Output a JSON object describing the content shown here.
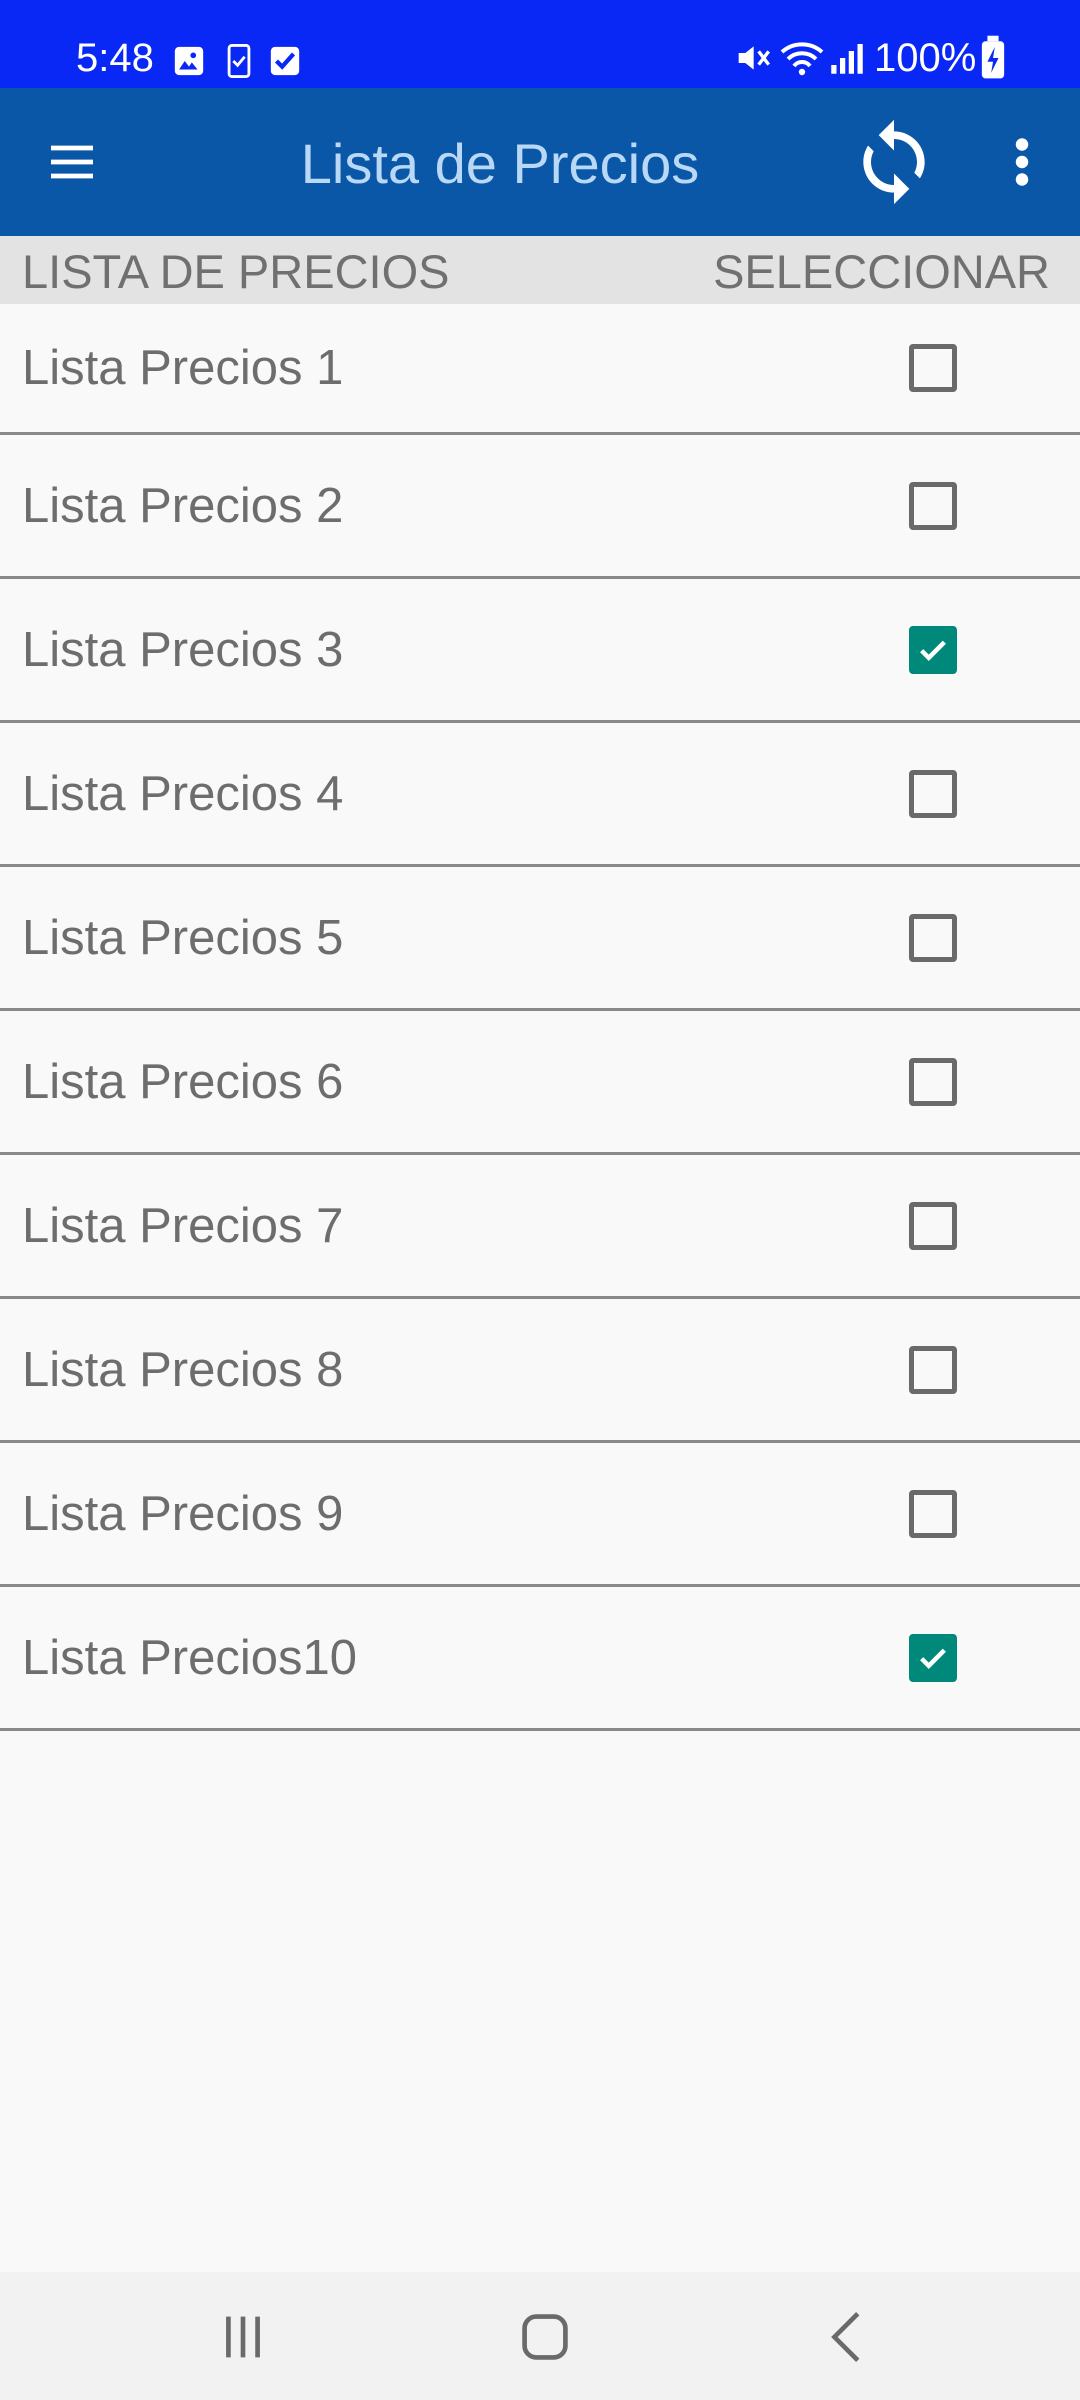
{
  "status_bar": {
    "time": "5:48",
    "battery": "100%",
    "icons": [
      "image-icon",
      "phone-icon",
      "check-box-icon",
      "mute-icon",
      "wifi-icon",
      "signal-icon",
      "battery-charging-icon"
    ]
  },
  "app_bar": {
    "title": "Lista de Precios",
    "icons": [
      "menu-icon",
      "sync-icon",
      "more-vert-icon"
    ]
  },
  "columns": {
    "name": "LISTA DE PRECIOS",
    "select": "SELECCIONAR"
  },
  "price_lists": [
    {
      "label": "Lista Precios 1",
      "checked": false
    },
    {
      "label": "Lista Precios 2",
      "checked": false
    },
    {
      "label": "Lista Precios 3",
      "checked": true
    },
    {
      "label": "Lista Precios 4",
      "checked": false
    },
    {
      "label": "Lista Precios 5",
      "checked": false
    },
    {
      "label": "Lista Precios 6",
      "checked": false
    },
    {
      "label": "Lista Precios 7",
      "checked": false
    },
    {
      "label": "Lista Precios 8",
      "checked": false
    },
    {
      "label": "Lista Precios 9",
      "checked": false
    },
    {
      "label": "Lista Precios10",
      "checked": true
    }
  ],
  "nav_bar": {
    "icons": [
      "recent-apps-icon",
      "home-icon",
      "back-icon"
    ]
  },
  "colors": {
    "status_bar": "#0a28f5",
    "app_bar": "#0a57a8",
    "title_text": "#b9d8f5",
    "checkbox_checked": "#00897b",
    "header_bg": "#e3e3e3"
  }
}
